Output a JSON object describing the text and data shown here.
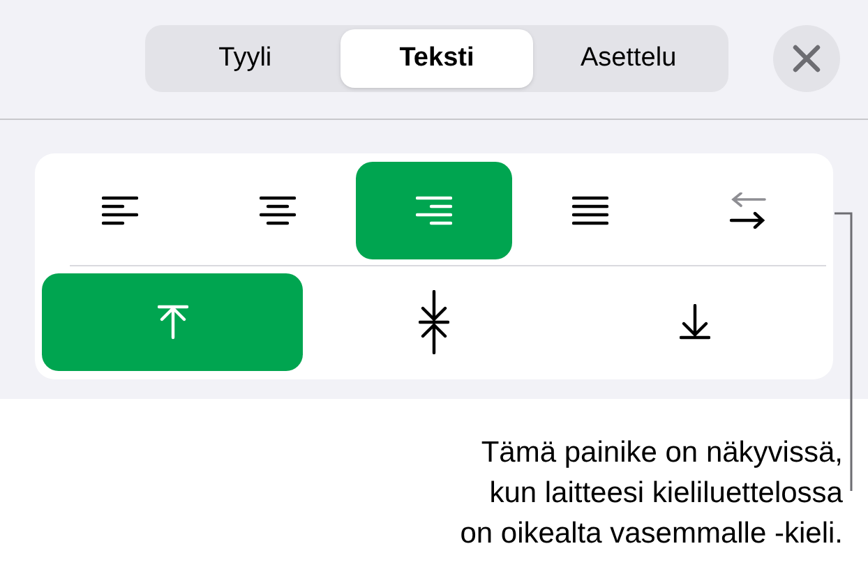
{
  "tabs": [
    {
      "label": "Tyyli",
      "selected": false
    },
    {
      "label": "Teksti",
      "selected": true
    },
    {
      "label": "Asettelu",
      "selected": false
    }
  ],
  "horizontal_alignment": [
    {
      "kind": "left",
      "selected": false
    },
    {
      "kind": "center",
      "selected": false
    },
    {
      "kind": "right",
      "selected": true
    },
    {
      "kind": "justify",
      "selected": false
    },
    {
      "kind": "rtl",
      "selected": false
    }
  ],
  "vertical_alignment": [
    {
      "kind": "top",
      "selected": true
    },
    {
      "kind": "middle",
      "selected": false
    },
    {
      "kind": "bottom",
      "selected": false
    }
  ],
  "callout": {
    "lines": [
      "Tämä painike on näkyvissä,",
      "kun laitteesi kieliluettelossa",
      "on oikealta vasemmalle -kieli."
    ]
  }
}
